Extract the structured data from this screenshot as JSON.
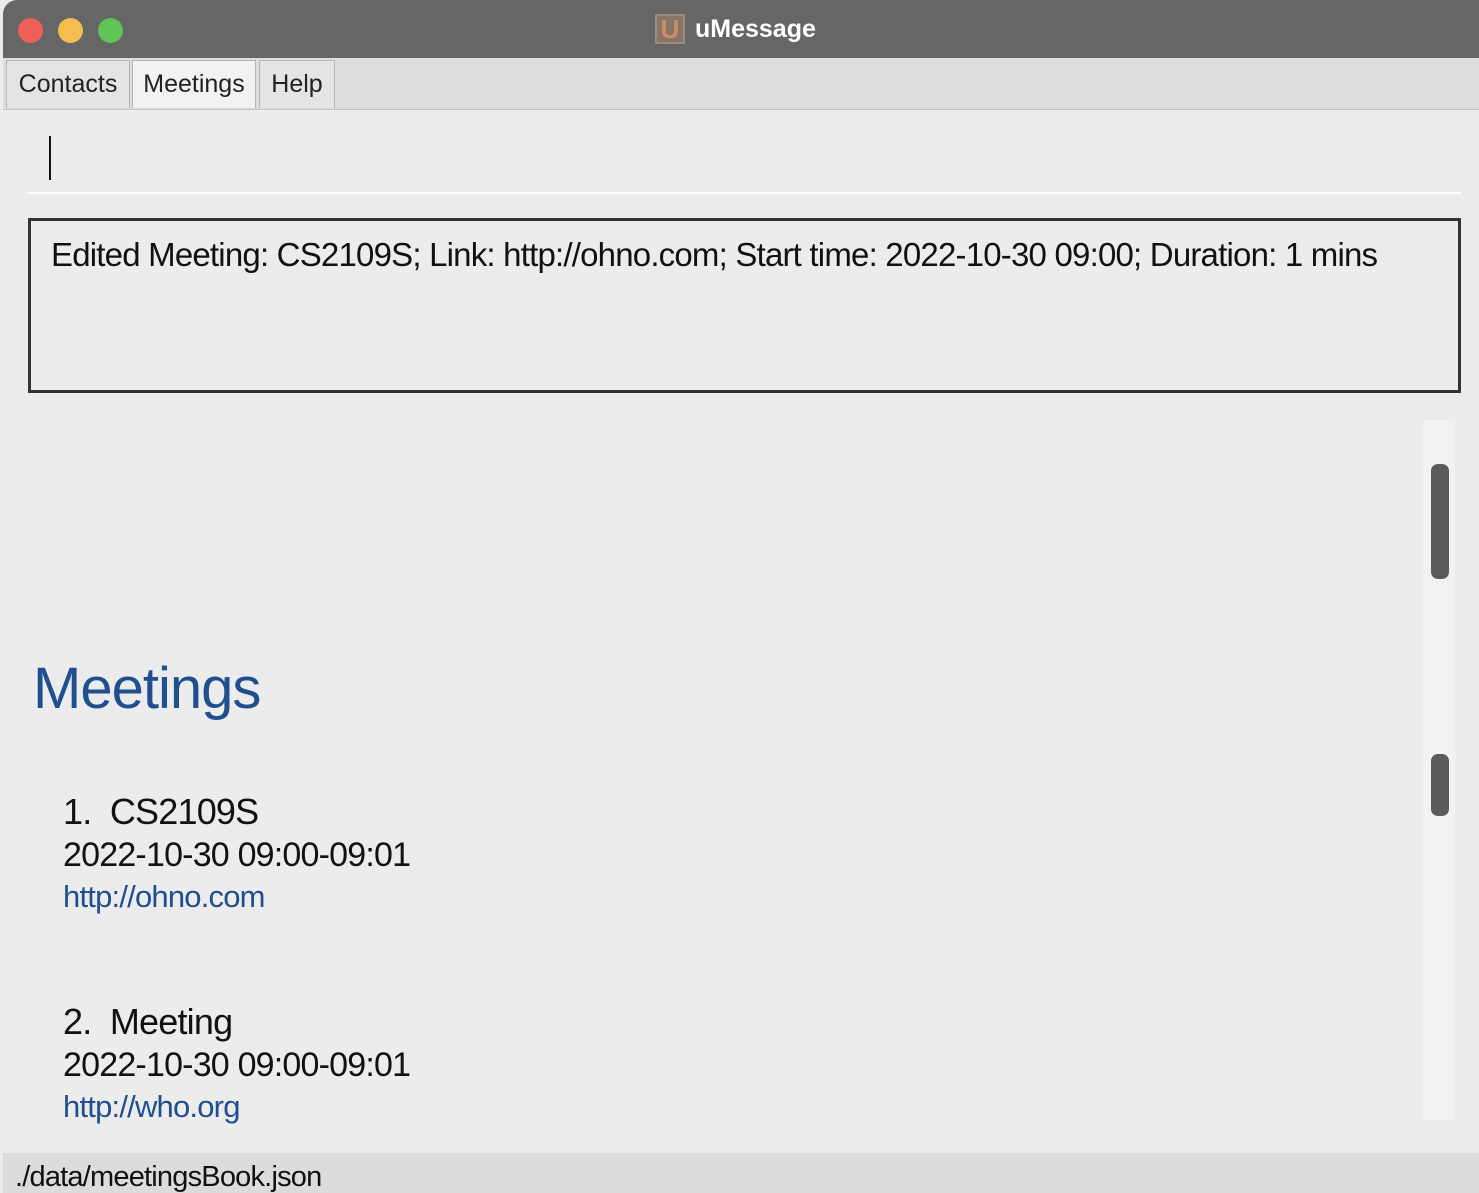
{
  "window": {
    "title": "uMessage",
    "logo_letter": "U",
    "controls": [
      "close",
      "minimize",
      "maximize"
    ]
  },
  "tabs": [
    {
      "label": "Contacts",
      "active": false
    },
    {
      "label": "Meetings",
      "active": true
    },
    {
      "label": "Help",
      "active": false
    }
  ],
  "command_input": {
    "value": "",
    "placeholder": ""
  },
  "result": {
    "text": "Edited Meeting: CS2109S; Link: http://ohno.com; Start time: 2022-10-30 09:00; Duration: 1 mins"
  },
  "meetings_panel": {
    "title": "Meetings",
    "items": [
      {
        "index": "1.",
        "title": "CS2109S",
        "time": "2022-10-30 09:00-09:01",
        "link": "http://ohno.com"
      },
      {
        "index": "2.",
        "title": "Meeting",
        "time": "2022-10-30 09:00-09:01",
        "link": "http://who.org"
      }
    ]
  },
  "status_bar": {
    "path": "./data/meetingsBook.json"
  },
  "colors": {
    "title_bar": "#666666",
    "accent": "#1f4f8f",
    "close": "#ee5f57",
    "minimize": "#f4bd4f",
    "maximize": "#60c554"
  }
}
